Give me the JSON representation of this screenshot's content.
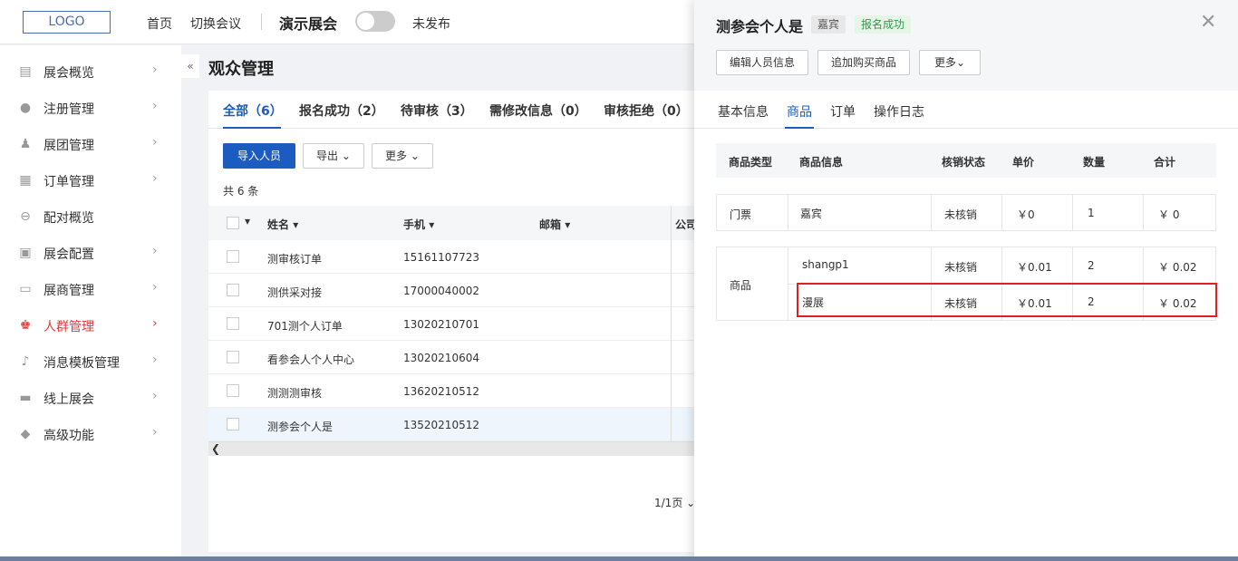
{
  "topbar": {
    "logo": "LOGO",
    "home": "首页",
    "switch": "切换会议",
    "expo_name": "演示展会",
    "publish_status": "未发布"
  },
  "sidebar": {
    "collapse": "«",
    "items": [
      {
        "label": "展会概览",
        "icon": "overview-icon",
        "arrow": "›"
      },
      {
        "label": "注册管理",
        "icon": "register-icon",
        "arrow": "›"
      },
      {
        "label": "展团管理",
        "icon": "group-icon",
        "arrow": "›"
      },
      {
        "label": "订单管理",
        "icon": "order-icon",
        "arrow": "›"
      },
      {
        "label": "配对概览",
        "icon": "match-icon",
        "arrow": ""
      },
      {
        "label": "展会配置",
        "icon": "config-icon",
        "arrow": "›"
      },
      {
        "label": "展商管理",
        "icon": "exhibitor-icon",
        "arrow": "›"
      },
      {
        "label": "人群管理",
        "icon": "people-icon",
        "arrow": "›"
      },
      {
        "label": "消息模板管理",
        "icon": "bell-icon",
        "arrow": "›"
      },
      {
        "label": "线上展会",
        "icon": "monitor-icon",
        "arrow": "›"
      },
      {
        "label": "高级功能",
        "icon": "tag-icon",
        "arrow": "›"
      }
    ],
    "active_color": "#e03c3c"
  },
  "main": {
    "title": "观众管理",
    "tabs": [
      "全部（6）",
      "报名成功（2）",
      "待审核（3）",
      "需修改信息（0）",
      "审核拒绝（0）"
    ],
    "import_btn": "导入人员",
    "export_btn": "导出",
    "more_btn": "更多",
    "total": "共 6 条",
    "columns": [
      "姓名",
      "手机",
      "邮箱",
      "公司"
    ],
    "rows": [
      {
        "name": "测审核订单",
        "phone": "15161107723"
      },
      {
        "name": "测供采对接",
        "phone": "17000040002"
      },
      {
        "name": "701测个人订单",
        "phone": "13020210701"
      },
      {
        "name": "看参会人个人中心",
        "phone": "13020210604"
      },
      {
        "name": "测测测审核",
        "phone": "13620210512"
      },
      {
        "name": "测参会个人是",
        "phone": "13520210512"
      }
    ],
    "pager": "1/1页"
  },
  "drawer": {
    "name": "测参会个人是",
    "role_badge": "嘉宾",
    "status_badge": "报名成功",
    "edit_btn": "编辑人员信息",
    "add_product_btn": "追加购买商品",
    "more_btn": "更多",
    "tabs": [
      "基本信息",
      "商品",
      "订单",
      "操作日志"
    ],
    "product_table": {
      "headers": [
        "商品类型",
        "商品信息",
        "核销状态",
        "单价",
        "数量",
        "合计"
      ],
      "ticket": {
        "type": "门票",
        "info": "嘉宾",
        "status": "未核销",
        "price": "￥0",
        "qty": "1",
        "total": "￥ 0"
      },
      "goods_type": "商品",
      "goods": [
        {
          "info": "shangp1",
          "status": "未核销",
          "price": "￥0.01",
          "qty": "2",
          "total": "￥ 0.02"
        },
        {
          "info": "漫展",
          "status": "未核销",
          "price": "￥0.01",
          "qty": "2",
          "total": "￥ 0.02"
        }
      ]
    }
  },
  "colors": {
    "primary": "#1c5bbf",
    "success": "#2a9d45",
    "highlight": "#e02020"
  }
}
